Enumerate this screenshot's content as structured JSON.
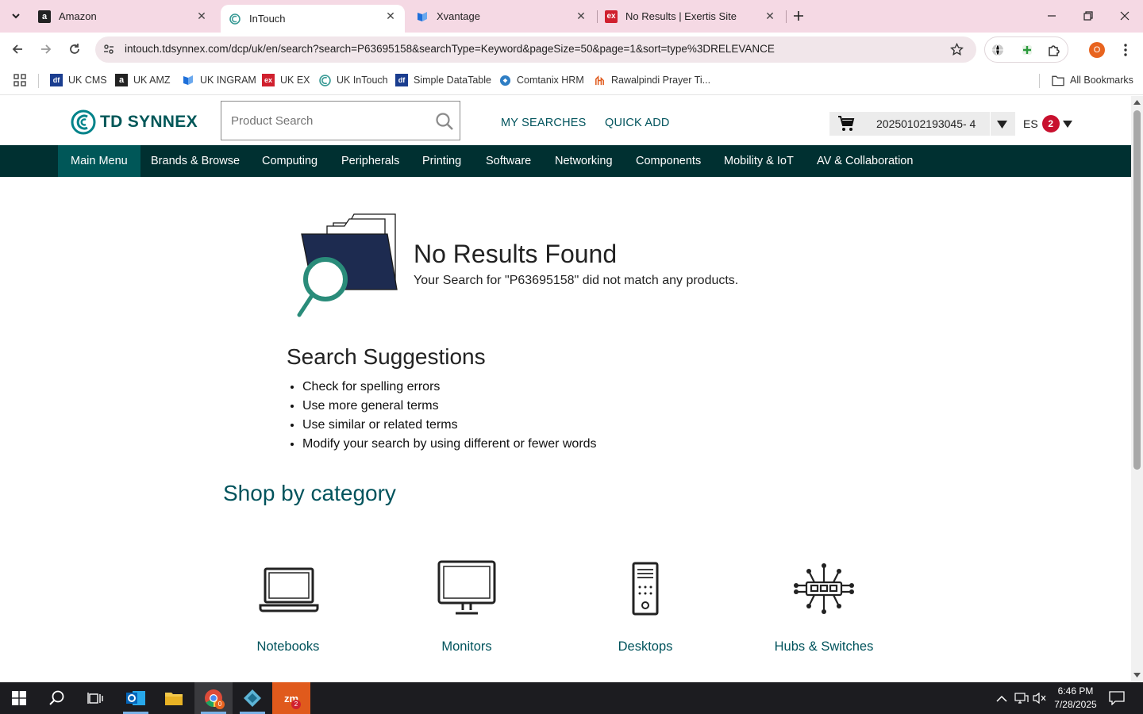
{
  "browser": {
    "tabs": [
      {
        "title": "Amazon",
        "icon": "amazon-icon"
      },
      {
        "title": "InTouch",
        "icon": "intouch-icon",
        "active": true
      },
      {
        "title": "Xvantage",
        "icon": "xvantage-icon"
      },
      {
        "title": "No Results | Exertis Site",
        "icon": "exertis-icon"
      }
    ],
    "url": "intouch.tdsynnex.com/dcp/uk/en/search?search=P63695158&searchType=Keyword&pageSize=50&page=1&sort=type%3DRELEVANCE",
    "profile_initial": "O",
    "bookmarks": [
      {
        "label": "UK CMS",
        "icon": "uk-cms-icon",
        "color": "#1a3d8f"
      },
      {
        "label": "UK AMZ",
        "icon": "amazon-icon",
        "color": "#222222"
      },
      {
        "label": "UK INGRAM",
        "icon": "ingram-icon",
        "color": "#1e6fd9"
      },
      {
        "label": "UK EX",
        "icon": "exertis-icon",
        "color": "#d0202e"
      },
      {
        "label": "UK InTouch",
        "icon": "intouch-icon",
        "color": "#3a9b96"
      },
      {
        "label": "Simple DataTable",
        "icon": "datatable-icon",
        "color": "#1a3d8f"
      },
      {
        "label": "Comtanix HRM",
        "icon": "comtanix-icon",
        "color": "#2f7ec4"
      },
      {
        "label": "Rawalpindi Prayer Ti...",
        "icon": "prayer-icon",
        "color": "#e05a1c"
      }
    ],
    "all_bookmarks": "All Bookmarks"
  },
  "site": {
    "logo_text": "TD SYNNEX",
    "search_placeholder": "Product Search",
    "my_searches": "MY SEARCHES",
    "quick_add": "QUICK ADD",
    "cart_id": "20250102193045- 4",
    "user_initials": "ES",
    "notif_count": "2",
    "nav": [
      "Main Menu",
      "Brands & Browse",
      "Computing",
      "Peripherals",
      "Printing",
      "Software",
      "Networking",
      "Components",
      "Mobility & IoT",
      "AV & Collaboration"
    ],
    "no_results_title": "No Results Found",
    "no_results_sub": "Your Search for \"P63695158\" did not match any products.",
    "suggestions_title": "Search Suggestions",
    "suggestions": [
      "Check for spelling errors",
      "Use more general terms",
      "Use similar or related terms",
      "Modify your search by using different or fewer words"
    ],
    "shop_title": "Shop by category",
    "categories": [
      {
        "label": "Notebooks",
        "icon": "laptop-icon"
      },
      {
        "label": "Monitors",
        "icon": "monitor-icon"
      },
      {
        "label": "Desktops",
        "icon": "desktop-tower-icon"
      },
      {
        "label": "Hubs & Switches",
        "icon": "network-switch-icon"
      }
    ],
    "brand_color": "#005758",
    "nav_bg": "#003031"
  },
  "taskbar": {
    "time": "6:46 PM",
    "date": "7/28/2025",
    "chrome_badge": "0",
    "zoom_badge": "2"
  }
}
